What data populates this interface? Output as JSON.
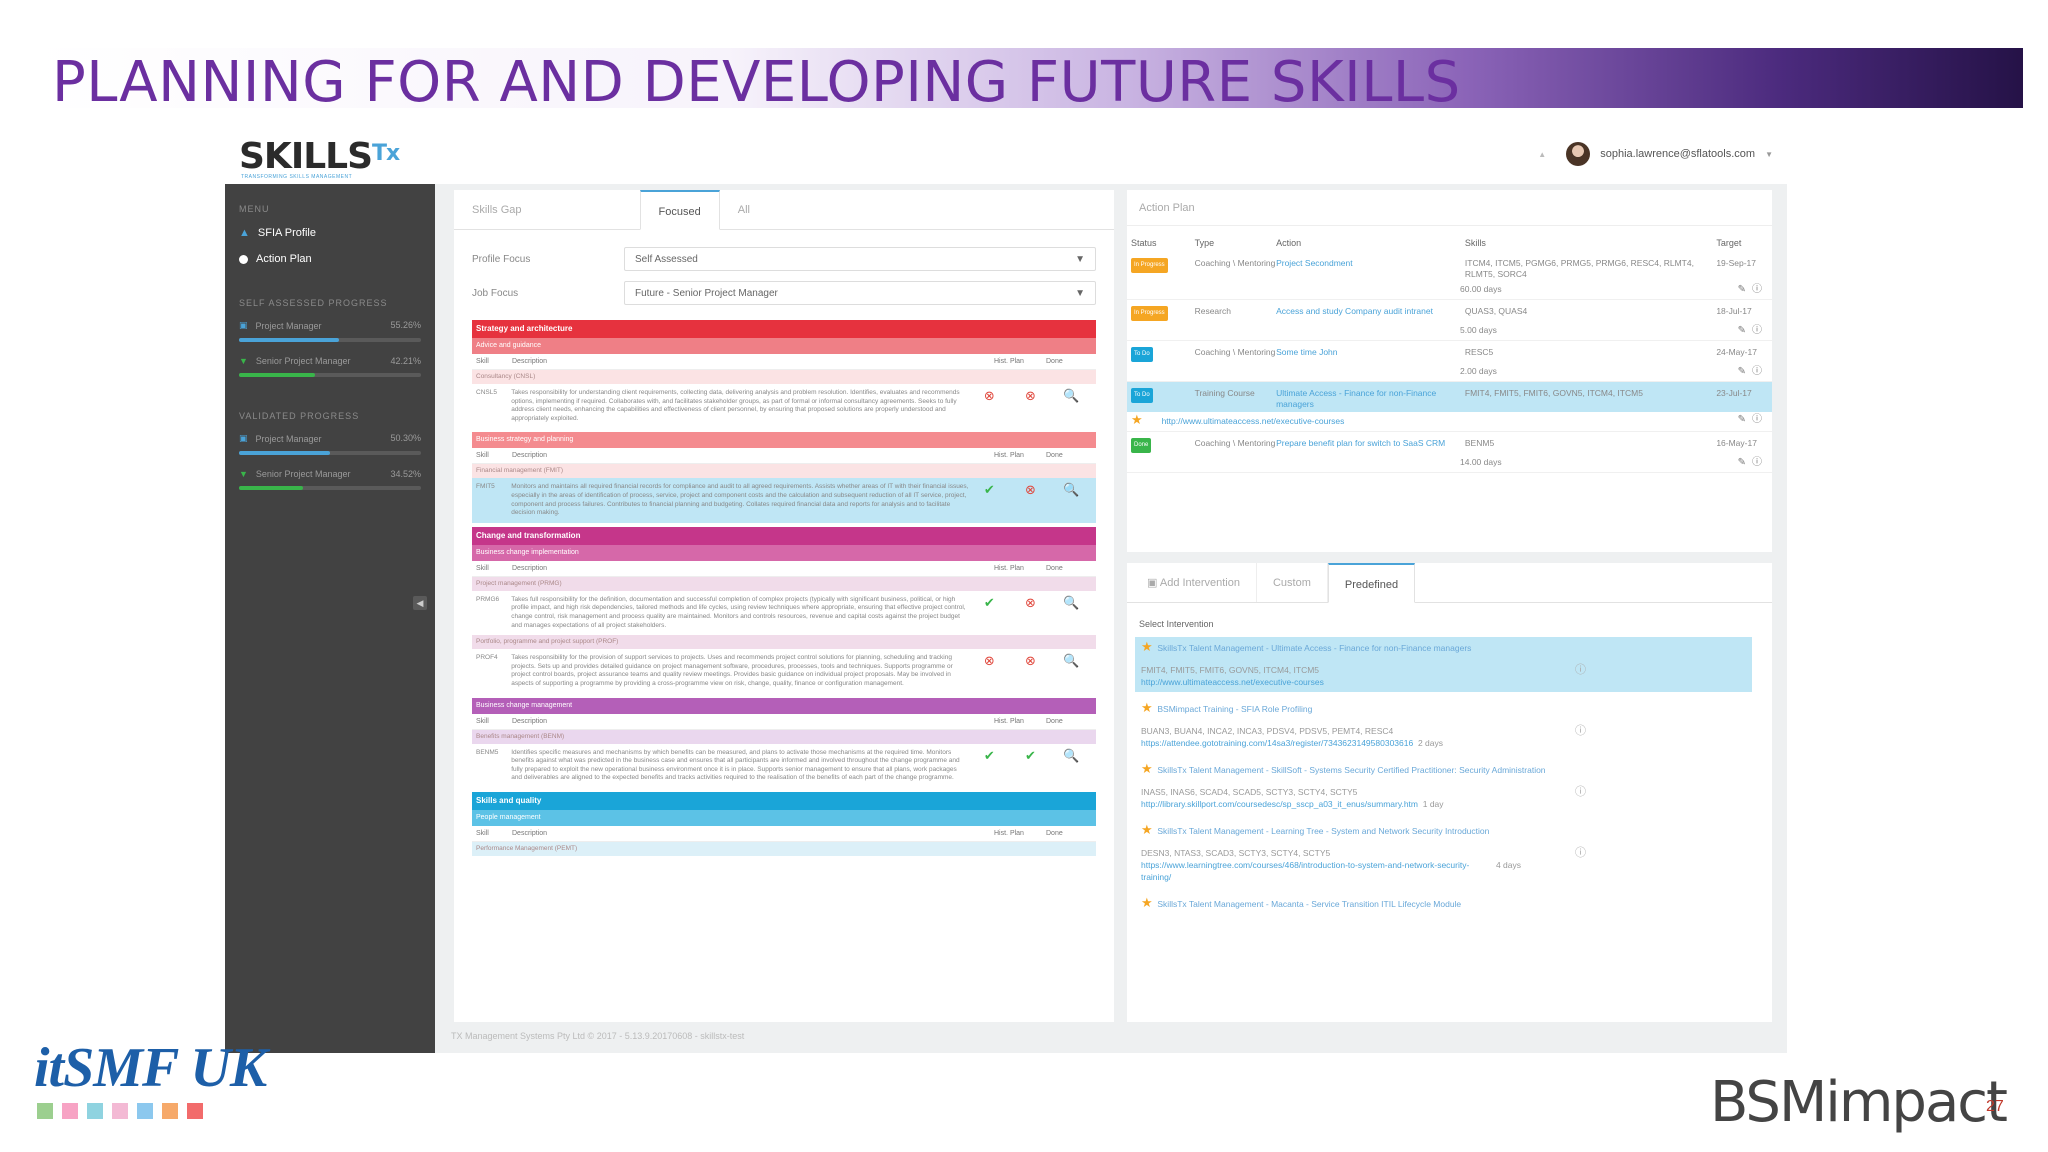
{
  "slide": {
    "title": "PLANNING FOR AND DEVELOPING FUTURE SKILLS",
    "page_number": "27",
    "itsmf_logo": "itSMF UK",
    "bsm_logo": "BSMimpact",
    "itsmf_squares": [
      "#9ccf8f",
      "#f7a3c4",
      "#8fd3e0",
      "#f3b9d4",
      "#8cc8ee",
      "#f6a96a",
      "#f26b6b"
    ]
  },
  "app": {
    "logo": "SKILLS",
    "logo_suffix": "Tx",
    "logo_tag": "TRANSFORMING SKILLS MANAGEMENT",
    "user_email": "sophia.lawrence@sflatools.com",
    "footer": "TX Management Systems Pty Ltd © 2017 - 5.13.9.20170608 - skillstx-test",
    "sidebar": {
      "menu_head": "MENU",
      "items": [
        "SFIA Profile",
        "Action Plan"
      ],
      "self_head": "SELF ASSESSED PROGRESS",
      "self": [
        {
          "label": "Project Manager",
          "value": "55.26%",
          "pct": 0.55,
          "color": "#4aa3d8"
        },
        {
          "label": "Senior Project Manager",
          "value": "42.21%",
          "pct": 0.42,
          "color": "#39b54a"
        }
      ],
      "valid_head": "VALIDATED PROGRESS",
      "valid": [
        {
          "label": "Project Manager",
          "value": "50.30%",
          "pct": 0.5,
          "color": "#4aa3d8"
        },
        {
          "label": "Senior Project Manager",
          "value": "34.52%",
          "pct": 0.35,
          "color": "#39b54a"
        }
      ]
    },
    "skills_gap": {
      "tabs": [
        "Skills Gap",
        "Focused",
        "All"
      ],
      "profile_focus_label": "Profile Focus",
      "profile_focus_value": "Self Assessed",
      "job_focus_label": "Job Focus",
      "job_focus_value": "Future - Senior Project Manager",
      "col_skill": "Skill",
      "col_desc": "Description",
      "col_plan": "Hist. Plan",
      "col_done": "Done",
      "cat1": "Strategy and architecture",
      "cat1_sub": "Advice and guidance",
      "grp1": "Consultancy (CNSL)",
      "code1": "CNSL5",
      "desc1": "Takes responsibility for understanding client requirements, collecting data, delivering analysis and problem resolution. Identifies, evaluates and recommends options, implementing if required. Collaborates with, and facilitates stakeholder groups, as part of formal or informal consultancy agreements. Seeks to fully address client needs, enhancing the capabilities and effectiveness of client personnel, by ensuring that proposed solutions are properly understood and appropriately exploited.",
      "cat1_sub2": "Business strategy and planning",
      "grp2": "Financial management (FMIT)",
      "code2": "FMIT5",
      "desc2": "Monitors and maintains all required financial records for compliance and audit to all agreed requirements. Assists whether areas of IT with their financial issues, especially in the areas of identification of process, service, project and component costs and the calculation and subsequent reduction of all IT service, project, component and process failures. Contributes to financial planning and budgeting. Collates required financial data and reports for analysis and to facilitate decision making.",
      "cat2": "Change and transformation",
      "cat2_sub": "Business change implementation",
      "grp3": "Project management (PRMG)",
      "code3": "PRMG6",
      "desc3": "Takes full responsibility for the definition, documentation and successful completion of complex projects (typically with significant business, political, or high profile impact, and high risk dependencies, tailored methods and life cycles, using review techniques where appropriate, ensuring that effective project control, change control, risk management and process quality are maintained. Monitors and controls resources, revenue and capital costs against the project budget and manages expectations of all project stakeholders.",
      "grp4": "Portfolio, programme and project support (PROF)",
      "code4": "PROF4",
      "desc4": "Takes responsibility for the provision of support services to projects. Uses and recommends project control solutions for planning, scheduling and tracking projects. Sets up and provides detailed guidance on project management software, procedures, processes, tools and techniques. Supports programme or project control boards, project assurance teams and quality review meetings. Provides basic guidance on individual project proposals. May be involved in aspects of supporting a programme by providing a cross-programme view on risk, change, quality, finance or configuration management.",
      "cat2_sub2": "Business change management",
      "grp5": "Benefits management (BENM)",
      "code5": "BENM5",
      "desc5": "Identifies specific measures and mechanisms by which benefits can be measured, and plans to activate those mechanisms at the required time. Monitors benefits against what was predicted in the business case and ensures that all participants are informed and involved throughout the change programme and fully prepared to exploit the new operational business environment once it is in place. Supports senior management to ensure that all plans, work packages and deliverables are aligned to the expected benefits and tracks activities required to the realisation of the benefits of each part of the change programme.",
      "cat3": "Skills and quality",
      "cat3_sub": "People management",
      "grp6": "Performance Management (PEMT)"
    },
    "action_plan": {
      "title": "Action Plan",
      "headers": [
        "Status",
        "Type",
        "Action",
        "Skills",
        "Target"
      ],
      "rows": [
        {
          "status": "In Progress",
          "type": "Coaching \\ Mentoring",
          "action": "Project Secondment",
          "skills": "ITCM4, ITCM5, PGMG6, PRMG5, PRMG6, RESC4, RLMT4, RLMT5, SORC4",
          "target": "19-Sep-17",
          "days": "60.00 days"
        },
        {
          "status": "In Progress",
          "type": "Research",
          "action": "Access and study Company audit intranet",
          "skills": "QUAS3, QUAS4",
          "target": "18-Jul-17",
          "days": "5.00 days"
        },
        {
          "status": "To Do",
          "type": "Coaching \\ Mentoring",
          "action": "Some time John",
          "skills": "RESC5",
          "target": "24-May-17",
          "days": "2.00 days"
        },
        {
          "status": "To Do",
          "type": "Training Course",
          "action": "Ultimate Access - Finance for non-Finance managers",
          "skills": "FMIT4, FMIT5, FMIT6, GOVN5, ITCM4, ITCM5",
          "target": "23-Jul-17",
          "link": "http://www.ultimateaccess.net/executive-courses"
        },
        {
          "status": "Done",
          "type": "Coaching \\ Mentoring",
          "action": "Prepare benefit plan for switch to SaaS CRM",
          "skills": "BENM5",
          "target": "16-May-17",
          "days": "14.00 days"
        }
      ]
    },
    "interventions": {
      "tabs": [
        "Add Intervention",
        "Custom",
        "Predefined"
      ],
      "select_label": "Select Intervention",
      "items": [
        {
          "title": "SkillsTx Talent Management - Ultimate Access - Finance for non-Finance managers",
          "skills": "FMIT4, FMIT5, FMIT6, GOVN5, ITCM4, ITCM5",
          "link": "http://www.ultimateaccess.net/executive-courses",
          "days": ""
        },
        {
          "title": "BSMimpact Training - SFIA Role Profiling",
          "skills": "BUAN3, BUAN4, INCA2, INCA3, PDSV4, PDSV5, PEMT4, RESC4",
          "link": "https://attendee.gototraining.com/14sa3/register/7343623149580303616",
          "days": "2 days"
        },
        {
          "title": "SkillsTx Talent Management - SkillSoft - Systems Security Certified Practitioner: Security Administration",
          "skills": "INAS5, INAS6, SCAD4, SCAD5, SCTY3, SCTY4, SCTY5",
          "link": "http://library.skillport.com/coursedesc/sp_sscp_a03_it_enus/summary.htm",
          "days": "1 day"
        },
        {
          "title": "SkillsTx Talent Management - Learning Tree - System and Network Security Introduction",
          "skills": "DESN3, NTAS3, SCAD3, SCTY3, SCTY4, SCTY5",
          "link": "https://www.learningtree.com/courses/468/introduction-to-system-and-network-security-training/",
          "days": "4 days"
        },
        {
          "title": "SkillsTx Talent Management - Macanta - Service Transition ITIL Lifecycle Module",
          "skills": "",
          "link": "",
          "days": ""
        }
      ]
    }
  }
}
